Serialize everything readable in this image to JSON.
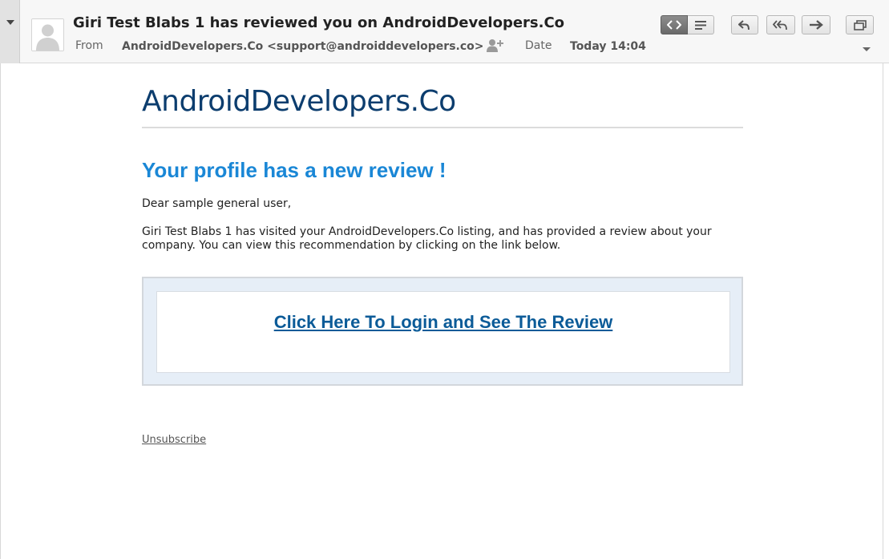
{
  "header": {
    "subject": "Giri Test Blabs 1 has reviewed you on AndroidDevelopers.Co",
    "from_label": "From",
    "from_value": "AndroidDevelopers.Co <support@androiddevelopers.co>",
    "date_label": "Date",
    "date_value": "Today 14:04",
    "toolbar_icons": [
      "html-view-icon",
      "text-view-icon",
      "reply-icon",
      "reply-all-icon",
      "forward-icon",
      "open-window-icon"
    ]
  },
  "email": {
    "logo_text": "AndroidDevelopers.Co",
    "headline": "Your profile has a new review !",
    "greeting": "Dear sample general user,",
    "body_text": "Giri Test Blabs 1 has visited your AndroidDevelopers.Co listing, and has provided a review about your company. You can view this recommendation by clicking on the link below.",
    "cta_label": "Click Here To Login and See The Review",
    "unsubscribe_label": "Unsubscribe"
  },
  "colors": {
    "logo": "#0c3d6e",
    "headline": "#1a87d6",
    "link": "#0b5b98",
    "cta_background": "#e6eef7"
  }
}
